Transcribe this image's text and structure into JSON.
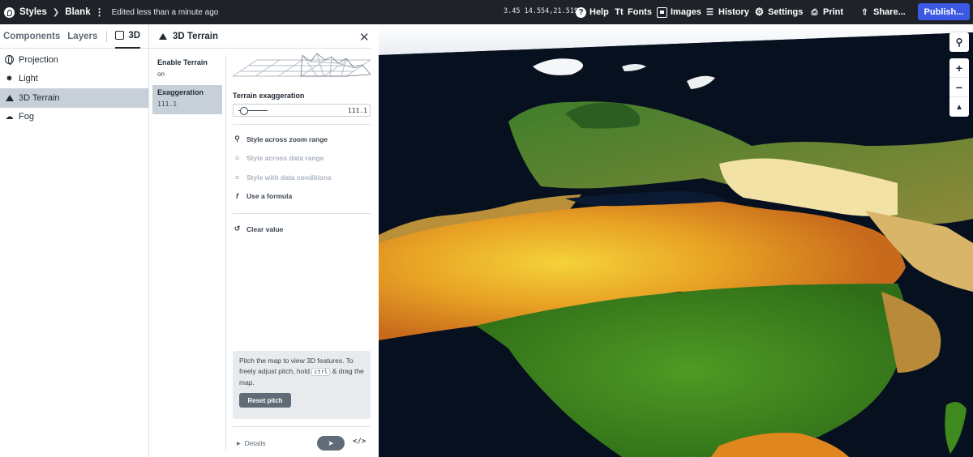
{
  "topbar": {
    "app": "Styles",
    "style_name": "Blank",
    "edited": "Edited less than a minute ago",
    "coords": "3.45 14.554,21.519",
    "help": "Help",
    "fonts": "Fonts",
    "images": "Images",
    "history": "History",
    "settings": "Settings",
    "print": "Print",
    "share": "Share...",
    "publish": "Publish..."
  },
  "sidebar": {
    "tabs": [
      "Components",
      "Layers",
      "3D"
    ],
    "items": [
      {
        "label": "Projection",
        "icon": "globe-icon"
      },
      {
        "label": "Light",
        "icon": "light-icon"
      },
      {
        "label": "3D Terrain",
        "icon": "terrain-icon"
      },
      {
        "label": "Fog",
        "icon": "fog-icon"
      }
    ],
    "selected": "3D Terrain"
  },
  "panel": {
    "title": "3D Terrain",
    "properties": [
      {
        "name": "Enable Terrain",
        "value": "on"
      },
      {
        "name": "Exaggeration",
        "value": "111.1"
      }
    ],
    "editor": {
      "label": "Terrain exaggeration",
      "value": "111.1",
      "options": [
        {
          "label": "Style across zoom range",
          "enabled": true
        },
        {
          "label": "Style across data range",
          "enabled": false
        },
        {
          "label": "Style with data conditions",
          "enabled": false
        },
        {
          "label": "Use a formula",
          "enabled": true
        }
      ],
      "clear": "Clear value"
    },
    "info": {
      "text_before": "Pitch the map to view 3D features. To freely adjust pitch, hold",
      "key": "ctrl",
      "text_after": "& drag the map.",
      "button": "Reset pitch"
    },
    "footer": {
      "details": "Details",
      "code": "</>"
    }
  },
  "map": {
    "controls": [
      "search-icon",
      "zoom-in-icon",
      "zoom-out-icon",
      "compass-icon"
    ],
    "colors": {
      "ocean": "#07101f",
      "sahara": "#e8a224",
      "vegetation": "#3f8a1e",
      "desert_light": "#f2e2a6",
      "snow": "#ffffff"
    }
  }
}
